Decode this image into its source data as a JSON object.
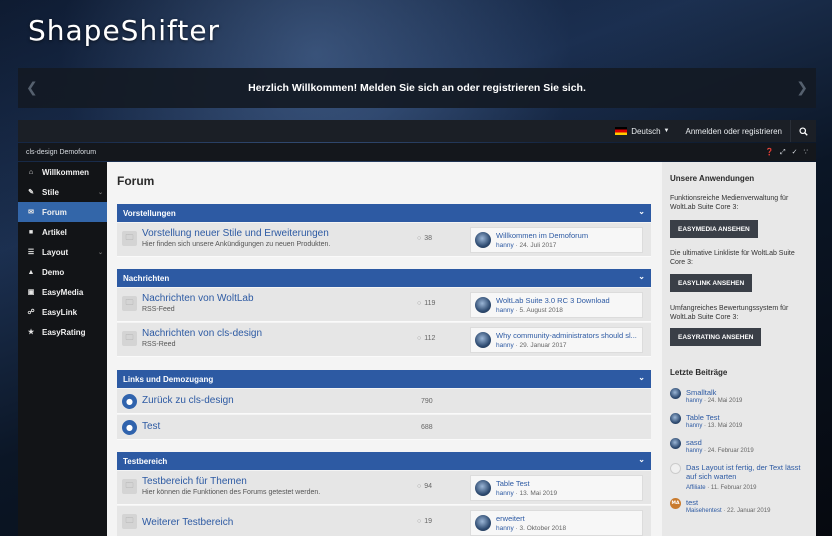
{
  "site": {
    "logo": "ShapeShifter"
  },
  "welcome": {
    "message": "Herzlich Willkommen! Melden Sie sich an oder registrieren Sie sich."
  },
  "topbar": {
    "language": "Deutsch",
    "login": "Anmelden oder registrieren"
  },
  "breadcrumb": "cls-design Demoforum",
  "sidebar": {
    "items": [
      {
        "label": "Willkommen",
        "icon": "home-icon"
      },
      {
        "label": "Stile",
        "icon": "brush-icon"
      },
      {
        "label": "Forum",
        "icon": "comments-icon"
      },
      {
        "label": "Artikel",
        "icon": "book-icon"
      },
      {
        "label": "Layout",
        "icon": "sliders-icon"
      },
      {
        "label": "Demo",
        "icon": "flame-icon"
      },
      {
        "label": "EasyMedia",
        "icon": "media-icon"
      },
      {
        "label": "EasyLink",
        "icon": "link-icon"
      },
      {
        "label": "EasyRating",
        "icon": "star-icon"
      }
    ]
  },
  "main": {
    "title": "Forum",
    "categories": [
      {
        "name": "Vorstellungen",
        "boards": [
          {
            "name": "Vorstellung neuer Stile und Erweiterungen",
            "desc": "Hier finden sich unsere Ankündigungen zu neuen Produkten.",
            "count": "38",
            "last_title": "Willkommen im Demoforum",
            "last_user": "hanny",
            "last_date": "24. Juli 2017"
          }
        ]
      },
      {
        "name": "Nachrichten",
        "boards": [
          {
            "name": "Nachrichten von WoltLab",
            "desc": "RSS-Feed",
            "count": "119",
            "last_title": "WoltLab Suite 3.0 RC 3 Download",
            "last_user": "hanny",
            "last_date": "5. August 2018"
          },
          {
            "name": "Nachrichten von cls-design",
            "desc": "RSS-Reed",
            "count": "112",
            "last_title": "Why community-administrators should sl...",
            "last_user": "hanny",
            "last_date": "29. Januar 2017"
          }
        ]
      },
      {
        "name": "Links und Demozugang",
        "links": [
          {
            "name": "Zurück zu cls-design",
            "count": "790"
          },
          {
            "name": "Test",
            "count": "688"
          }
        ]
      },
      {
        "name": "Testbereich",
        "boards": [
          {
            "name": "Testbereich für Themen",
            "desc": "Hier können die Funktionen des Forums getestet werden.",
            "count": "94",
            "last_title": "Table Test",
            "last_user": "hanny",
            "last_date": "13. Mai 2019"
          },
          {
            "name": "Weiterer Testbereich",
            "desc": "",
            "count": "19",
            "last_title": "erweitert",
            "last_user": "hanny",
            "last_date": "3. Oktober 2018"
          }
        ]
      }
    ]
  },
  "right": {
    "apps_title": "Unsere Anwendungen",
    "apps": [
      {
        "text": "Funktionsreiche Medienverwaltung für WoltLab Suite Core 3:",
        "button": "EASYMEDIA ANSEHEN"
      },
      {
        "text": "Die ultimative Linkliste für WoltLab Suite Core 3:",
        "button": "EASYLINK ANSEHEN"
      },
      {
        "text": "Umfangreiches Bewertungssystem für WoltLab Suite Core 3:",
        "button": "EASYRATING ANSEHEN"
      }
    ],
    "posts_title": "Letzte Beiträge",
    "posts": [
      {
        "title": "Smalltalk",
        "user": "hanny",
        "date": "24. Mai 2019"
      },
      {
        "title": "Table Test",
        "user": "hanny",
        "date": "13. Mai 2019"
      },
      {
        "title": "sasd",
        "user": "hanny",
        "date": "24. Februar 2019"
      },
      {
        "title": "Das Layout ist fertig, der Text lässt auf sich warten",
        "user": "Affiliate",
        "date": "11. Februar 2019"
      },
      {
        "title": "test",
        "user": "Maisehentest",
        "date": "22. Januar 2019",
        "avatar": "MA"
      }
    ]
  },
  "colors": {
    "accent": "#2d5aa3",
    "active_nav": "#3366a9",
    "topbar": "#1b1f26"
  }
}
